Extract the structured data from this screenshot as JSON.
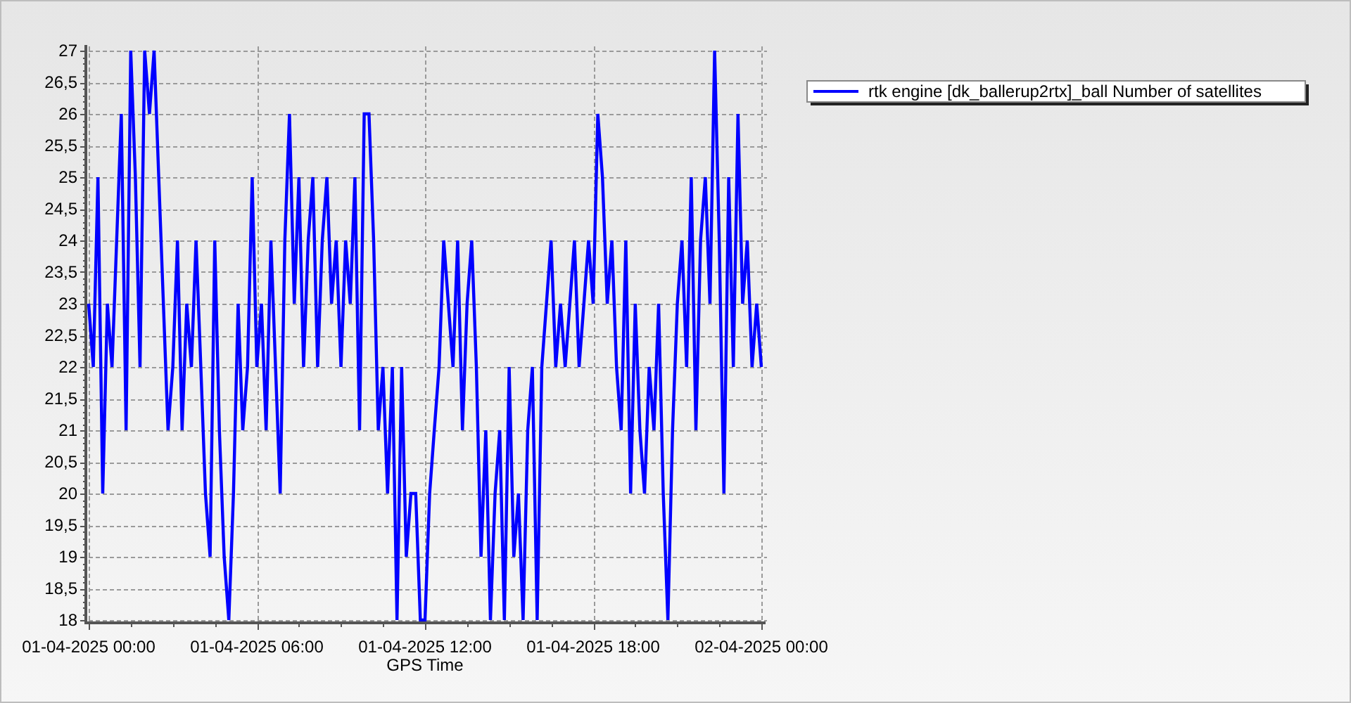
{
  "chart_data": {
    "type": "line",
    "grid": true,
    "xlabel": "GPS Time",
    "yticks": [
      {
        "value": 18,
        "label": "18"
      },
      {
        "value": 18.5,
        "label": "18,5"
      },
      {
        "value": 19,
        "label": "19"
      },
      {
        "value": 19.5,
        "label": "19,5"
      },
      {
        "value": 20,
        "label": "20"
      },
      {
        "value": 20.5,
        "label": "20,5"
      },
      {
        "value": 21,
        "label": "21"
      },
      {
        "value": 21.5,
        "label": "21,5"
      },
      {
        "value": 22,
        "label": "22"
      },
      {
        "value": 22.5,
        "label": "22,5"
      },
      {
        "value": 23,
        "label": "23"
      },
      {
        "value": 23.5,
        "label": "23,5"
      },
      {
        "value": 24,
        "label": "24"
      },
      {
        "value": 24.5,
        "label": "24,5"
      },
      {
        "value": 25,
        "label": "25"
      },
      {
        "value": 25.5,
        "label": "25,5"
      },
      {
        "value": 26,
        "label": "26"
      },
      {
        "value": 26.5,
        "label": "26,5"
      },
      {
        "value": 27,
        "label": "27"
      }
    ],
    "ylim": [
      18,
      27
    ],
    "categories": [
      "01-04-2025 00:00",
      null,
      null,
      null,
      null,
      null,
      null,
      null,
      null,
      null,
      null,
      null,
      null,
      null,
      null,
      null,
      null,
      null,
      null,
      null,
      null,
      null,
      null,
      null,
      null,
      null,
      null,
      null,
      null,
      null,
      null,
      null,
      null,
      null,
      null,
      null,
      "01-04-2025 06:00",
      null,
      null,
      null,
      null,
      null,
      null,
      null,
      null,
      null,
      null,
      null,
      null,
      null,
      null,
      null,
      null,
      null,
      null,
      null,
      null,
      null,
      null,
      null,
      null,
      null,
      null,
      null,
      null,
      null,
      null,
      null,
      null,
      null,
      null,
      null,
      "01-04-2025 12:00",
      null,
      null,
      null,
      null,
      null,
      null,
      null,
      null,
      null,
      null,
      null,
      null,
      null,
      null,
      null,
      null,
      null,
      null,
      null,
      null,
      null,
      null,
      null,
      null,
      null,
      null,
      null,
      null,
      null,
      null,
      null,
      null,
      null,
      null,
      null,
      "01-04-2025 18:00",
      null,
      null,
      null,
      null,
      null,
      null,
      null,
      null,
      null,
      null,
      null,
      null,
      null,
      null,
      null,
      null,
      null,
      null,
      null,
      null,
      null,
      null,
      null,
      null,
      null,
      null,
      null,
      null,
      null,
      null,
      null,
      null,
      null,
      null,
      null,
      "02-04-2025 00:00"
    ],
    "series": [
      {
        "name": "rtk engine [dk_ballerup2rtx]_ball Number of satellites",
        "color": "#0000ff",
        "values": [
          23,
          22,
          25,
          20,
          23,
          22,
          24,
          26,
          21,
          27,
          25,
          22,
          27,
          26,
          27,
          25,
          23,
          21,
          22,
          24,
          21,
          23,
          22,
          24,
          22,
          20,
          19,
          24,
          21,
          19,
          18,
          20,
          23,
          21,
          22,
          25,
          22,
          23,
          21,
          24,
          22,
          20,
          24,
          26,
          23,
          25,
          22,
          24,
          25,
          22,
          24,
          25,
          23,
          24,
          22,
          24,
          23,
          25,
          21,
          26,
          26,
          24,
          21,
          22,
          20,
          22,
          18,
          22,
          19,
          20,
          20,
          18,
          18,
          20,
          21,
          22,
          24,
          23,
          22,
          24,
          21,
          23,
          24,
          22,
          19,
          21,
          18,
          20,
          21,
          18,
          22,
          19,
          20,
          18,
          21,
          22,
          18,
          22,
          23,
          24,
          22,
          23,
          22,
          23,
          24,
          22,
          23,
          24,
          23,
          26,
          25,
          23,
          24,
          22,
          21,
          24,
          20,
          23,
          21,
          20,
          22,
          21,
          23,
          20,
          18,
          21,
          23,
          24,
          22,
          25,
          21,
          24,
          25,
          23,
          27,
          24,
          20,
          25,
          22,
          26,
          23,
          24,
          22,
          23,
          22
        ]
      }
    ]
  }
}
